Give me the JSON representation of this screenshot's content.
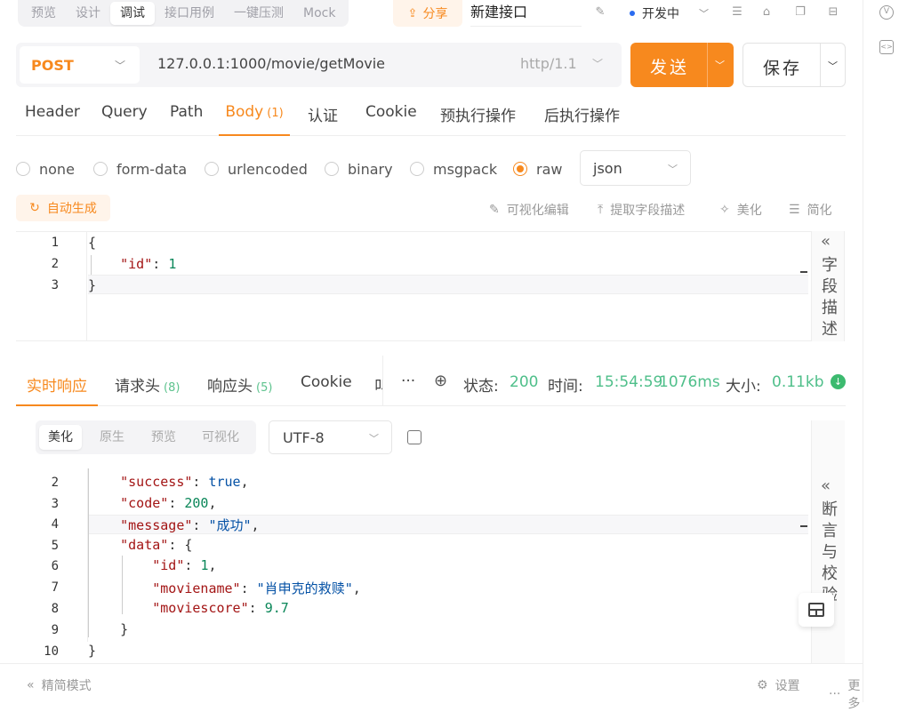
{
  "top": {
    "tabs": [
      "预览",
      "设计",
      "调试",
      "接口用例",
      "一键压测",
      "Mock"
    ],
    "active_tab": "调试",
    "share_label": "分享",
    "doc_name": "新建接口",
    "env_label": "开发中"
  },
  "request": {
    "method": "POST",
    "url": "127.0.0.1:1000/movie/getMovie",
    "protocol": "http/1.1",
    "send_label": "发送",
    "save_label": "保存",
    "tabs": [
      {
        "label": "Header"
      },
      {
        "label": "Query"
      },
      {
        "label": "Path"
      },
      {
        "label": "Body",
        "badge": "(1)"
      },
      {
        "label": "认证"
      },
      {
        "label": "Cookie"
      },
      {
        "label": "预执行操作"
      },
      {
        "label": "后执行操作"
      }
    ],
    "active_tab": "Body",
    "body_types": [
      "none",
      "form-data",
      "urlencoded",
      "binary",
      "msgpack",
      "raw"
    ],
    "selected_body_type": "raw",
    "raw_format": "json",
    "autogen_label": "自动生成",
    "tools": [
      "可视化编辑",
      "提取字段描述",
      "美化",
      "简化"
    ],
    "side_panel_label": "字段描述",
    "body_lines": [
      "1",
      "2",
      "3"
    ]
  },
  "response": {
    "tabs": [
      {
        "label": "实时响应"
      },
      {
        "label": "请求头",
        "count": "(8)"
      },
      {
        "label": "响应头",
        "count": "(5)"
      },
      {
        "label": "Cookie"
      },
      {
        "label": "叫"
      }
    ],
    "active_tab": "实时响应",
    "more": "···",
    "status_label": "状态:",
    "status_value": "200",
    "time_label": "时间:",
    "time_value": "15:54:59",
    "duration": "1076ms",
    "size_label": "大小:",
    "size_value": "0.11kb",
    "format_tabs": [
      "美化",
      "原生",
      "预览",
      "可视化"
    ],
    "active_format": "美化",
    "encoding": "UTF-8",
    "side_panel_label": "断言与校验",
    "line_numbers": [
      "2",
      "3",
      "4",
      "5",
      "6",
      "7",
      "8",
      "9",
      "10"
    ],
    "json": {
      "success": "true",
      "code": "200",
      "message": "\"成功\"",
      "id": "1",
      "moviename": "\"肖申克的救赎\"",
      "moviescore": "9.7"
    }
  },
  "bottom": {
    "simple_mode": "精简模式",
    "settings": "设置",
    "more": "更多"
  }
}
